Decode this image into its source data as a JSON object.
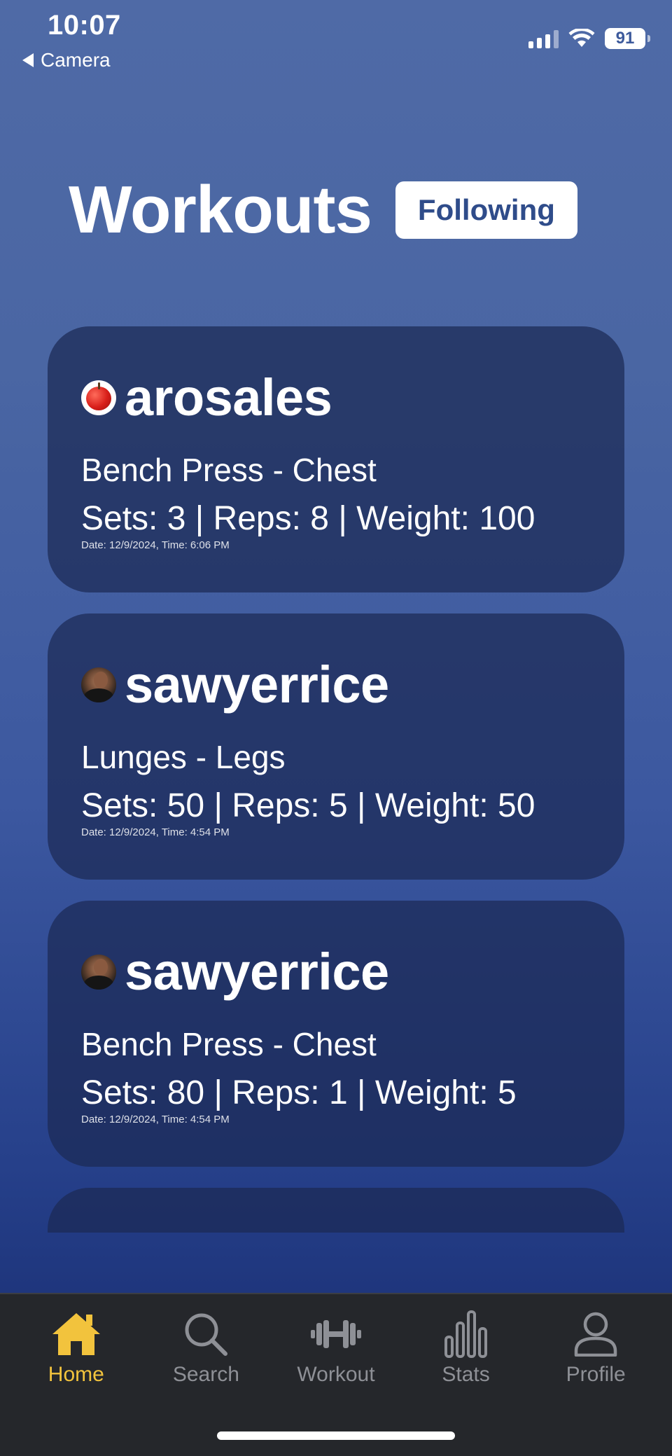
{
  "status_bar": {
    "time": "10:07",
    "back_app": "Camera",
    "battery": "91"
  },
  "header": {
    "title": "Workouts",
    "filter_button": "Following"
  },
  "workouts": [
    {
      "username": "arosales",
      "avatar": "apple-avatar",
      "exercise": "Bench Press - Chest",
      "stats": "Sets: 3 | Reps: 8 | Weight: 100",
      "timestamp": "Date: 12/9/2024, Time: 6:06 PM"
    },
    {
      "username": "sawyerrice",
      "avatar": "person-photo-avatar",
      "exercise": "Lunges - Legs",
      "stats": "Sets: 50 | Reps: 5 | Weight: 50",
      "timestamp": "Date: 12/9/2024, Time: 4:54 PM"
    },
    {
      "username": "sawyerrice",
      "avatar": "person-photo-avatar",
      "exercise": "Bench Press - Chest",
      "stats": "Sets: 80 | Reps: 1 | Weight: 5",
      "timestamp": "Date: 12/9/2024, Time: 4:54 PM"
    }
  ],
  "tab_bar": {
    "active_color": "#f2c33d",
    "inactive_color": "#8e9096",
    "tabs": [
      {
        "label": "Home",
        "icon": "home-icon",
        "active": true
      },
      {
        "label": "Search",
        "icon": "search-icon",
        "active": false
      },
      {
        "label": "Workout",
        "icon": "dumbbell-icon",
        "active": false
      },
      {
        "label": "Stats",
        "icon": "bar-chart-icon",
        "active": false
      },
      {
        "label": "Profile",
        "icon": "person-icon",
        "active": false
      }
    ]
  }
}
